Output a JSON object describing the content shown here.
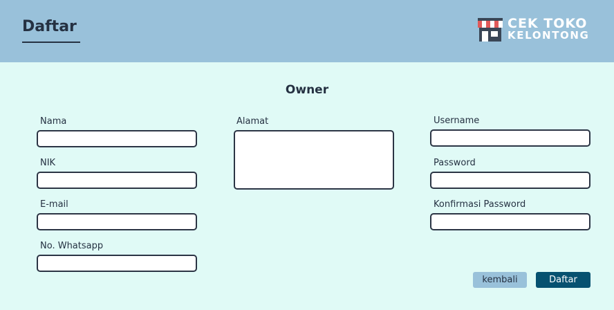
{
  "header": {
    "title": "Daftar",
    "logo": {
      "line1": "CEK TOKO",
      "line2": "KELONTONG",
      "icon": "store-icon"
    }
  },
  "form": {
    "section_title": "Owner",
    "fields": {
      "nama": {
        "label": "Nama",
        "value": ""
      },
      "nik": {
        "label": "NIK",
        "value": ""
      },
      "email": {
        "label": "E-mail",
        "value": ""
      },
      "whatsapp": {
        "label": "No. Whatsapp",
        "value": ""
      },
      "alamat": {
        "label": "Alamat",
        "value": ""
      },
      "username": {
        "label": "Username",
        "value": ""
      },
      "password": {
        "label": "Password",
        "value": ""
      },
      "konfirmasi": {
        "label": "Konfirmasi Password",
        "value": ""
      }
    },
    "buttons": {
      "back": "kembali",
      "submit": "Daftar"
    }
  },
  "colors": {
    "header_bg": "#99c1da",
    "page_bg": "#e0faf6",
    "primary_button": "#065170",
    "secondary_button": "#99c1da",
    "text": "#253142"
  }
}
